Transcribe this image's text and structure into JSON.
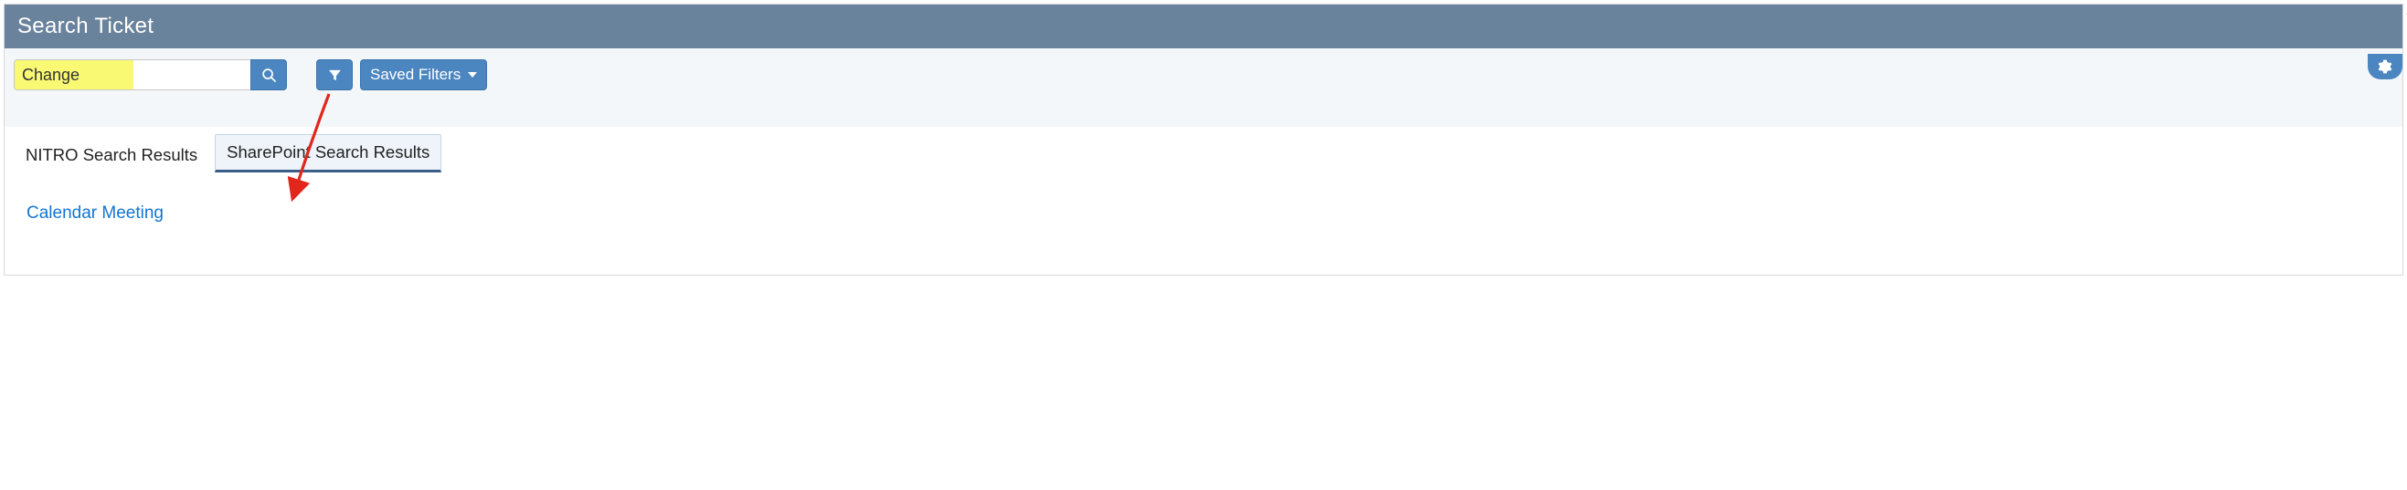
{
  "header": {
    "title": "Search Ticket"
  },
  "toolbar": {
    "search_value": "Change",
    "saved_filters_label": "Saved Filters"
  },
  "tabs": [
    {
      "label": "NITRO Search Results",
      "active": false
    },
    {
      "label": "SharePoint Search Results",
      "active": true
    }
  ],
  "results": [
    {
      "title": "Calendar Meeting"
    }
  ],
  "colors": {
    "header_bg": "#6a839c",
    "button_bg": "#4b86c1",
    "highlight": "#f9f974",
    "link": "#1275d1",
    "arrow": "#e1261c"
  }
}
